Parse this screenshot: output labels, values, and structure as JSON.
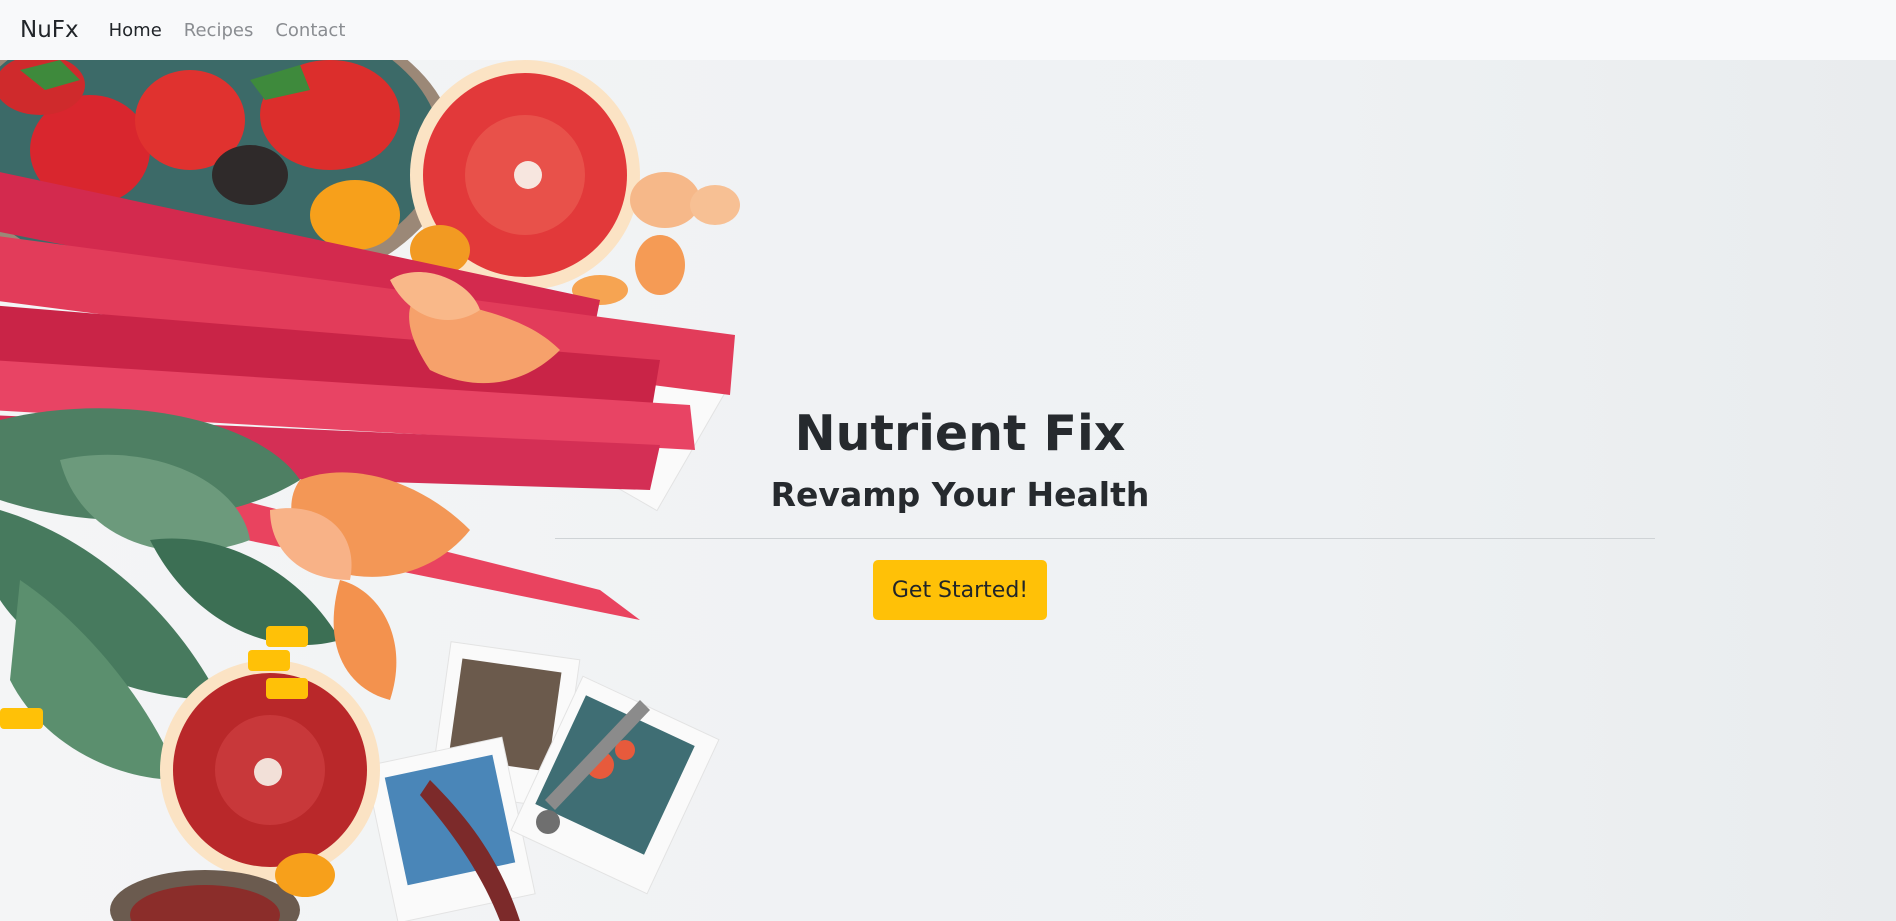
{
  "navbar": {
    "brand": "NuFx",
    "links": [
      {
        "label": "Home",
        "active": true
      },
      {
        "label": "Recipes",
        "active": false
      },
      {
        "label": "Contact",
        "active": false
      }
    ]
  },
  "hero": {
    "title": "Nutrient Fix",
    "subtitle": "Revamp Your Health",
    "cta_label": "Get Started!"
  },
  "colors": {
    "accent": "#ffc107",
    "text": "#212529",
    "navbar_bg": "#f8f9fa"
  }
}
